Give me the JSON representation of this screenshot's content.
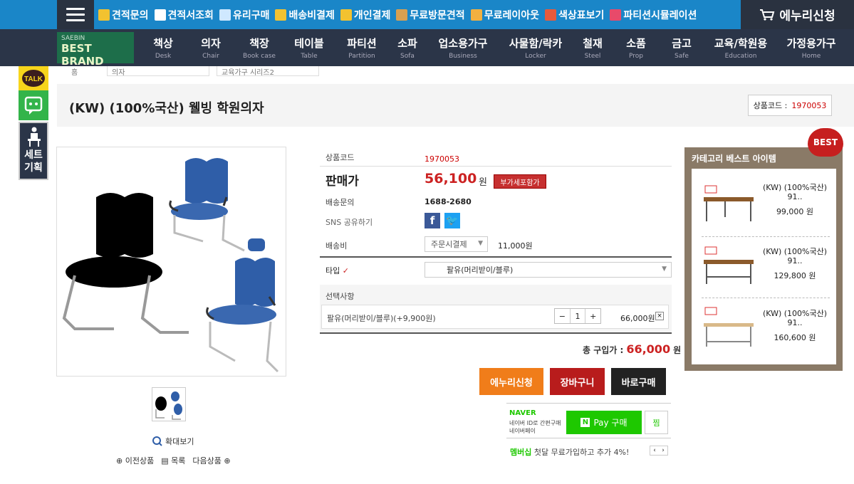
{
  "top_menu": [
    {
      "label": "견적문의",
      "icon": "quote-icon",
      "color": "#f2c230"
    },
    {
      "label": "견적서조회",
      "icon": "document-icon",
      "color": "#ffffff"
    },
    {
      "label": "유리구매",
      "icon": "glass-icon",
      "color": "#cfe8ff"
    },
    {
      "label": "배송비결제",
      "icon": "truck-icon",
      "color": "#f2c230"
    },
    {
      "label": "개인결제",
      "icon": "card-icon",
      "color": "#f2c230"
    },
    {
      "label": "무료방문견적",
      "icon": "box-icon",
      "color": "#d9a050"
    },
    {
      "label": "무료레이아웃",
      "icon": "tools-icon",
      "color": "#f2b040"
    },
    {
      "label": "색상표보기",
      "icon": "palette-icon",
      "color": "#e85a3a"
    },
    {
      "label": "파티션시뮬레이션",
      "icon": "partition-icon",
      "color": "#e84a6a"
    }
  ],
  "enuri_top": "에누리신청",
  "brand": {
    "line1": "SAEBIN",
    "line2": "BEST BRAND"
  },
  "categories": [
    {
      "ko": "책상",
      "en": "Desk"
    },
    {
      "ko": "의자",
      "en": "Chair"
    },
    {
      "ko": "책장",
      "en": "Book case"
    },
    {
      "ko": "테이블",
      "en": "Table"
    },
    {
      "ko": "파티션",
      "en": "Partition"
    },
    {
      "ko": "소파",
      "en": "Sofa"
    },
    {
      "ko": "업소용가구",
      "en": "Business"
    },
    {
      "ko": "사물함/락카",
      "en": "Locker"
    },
    {
      "ko": "철재",
      "en": "Steel"
    },
    {
      "ko": "소품",
      "en": "Prop"
    },
    {
      "ko": "금고",
      "en": "Safe"
    },
    {
      "ko": "교육/학원용",
      "en": "Education"
    },
    {
      "ko": "가정용가구",
      "en": "Home"
    }
  ],
  "side": {
    "talk": "TALK",
    "set": "세트기획"
  },
  "breadcrumb": [
    "홈",
    "의자",
    "교육가구 시리즈2"
  ],
  "product": {
    "title": "(KW) (100%국산) 웰빙 학원의자",
    "code_label": "상품코드 :",
    "code": "1970053"
  },
  "info": {
    "code_label": "상품코드",
    "code": "1970053",
    "price_label": "판매가",
    "price": "56,100",
    "won": "원",
    "vat_button": "부가세포함가",
    "delivery_label": "배송문의",
    "delivery_phone": "1688-2680",
    "sns_label": "SNS 공유하기",
    "ship_label": "배송비",
    "ship_select": "주문시결제",
    "ship_fee": "11,000원",
    "type_label": "타입",
    "type_value": "팔유(머리받이/블루)",
    "option_header": "선택사항",
    "option_name": "팔유(머리받이/블루)(+9,900원)",
    "qty": "1",
    "option_price": "66,000원",
    "total_label": "총 구입가 :",
    "total_value": "66,000",
    "total_won": "원"
  },
  "buttons": {
    "enuri": "에누리신청",
    "cart": "장바구니",
    "buy": "바로구매"
  },
  "naver": {
    "logo": "NAVER",
    "desc1": "네이버 ID로 간편구매",
    "desc2": "네이버페이",
    "pay_button": "Pay 구매",
    "wish": "찜",
    "member_em": "멤버십",
    "member_text": "첫달 무료가입하고 추가 4%!"
  },
  "gallery": {
    "zoom": "확대보기",
    "prev": "이전상품",
    "list": "목록",
    "next": "다음상품"
  },
  "best": {
    "badge": "BEST",
    "title": "카테고리 베스트 아이템",
    "items": [
      {
        "name": "(KW) (100%국산) 91..",
        "price": "99,000 원"
      },
      {
        "name": "(KW) (100%국산) 91..",
        "price": "129,800 원"
      },
      {
        "name": "(KW) (100%국산) 91..",
        "price": "160,600 원"
      }
    ]
  }
}
